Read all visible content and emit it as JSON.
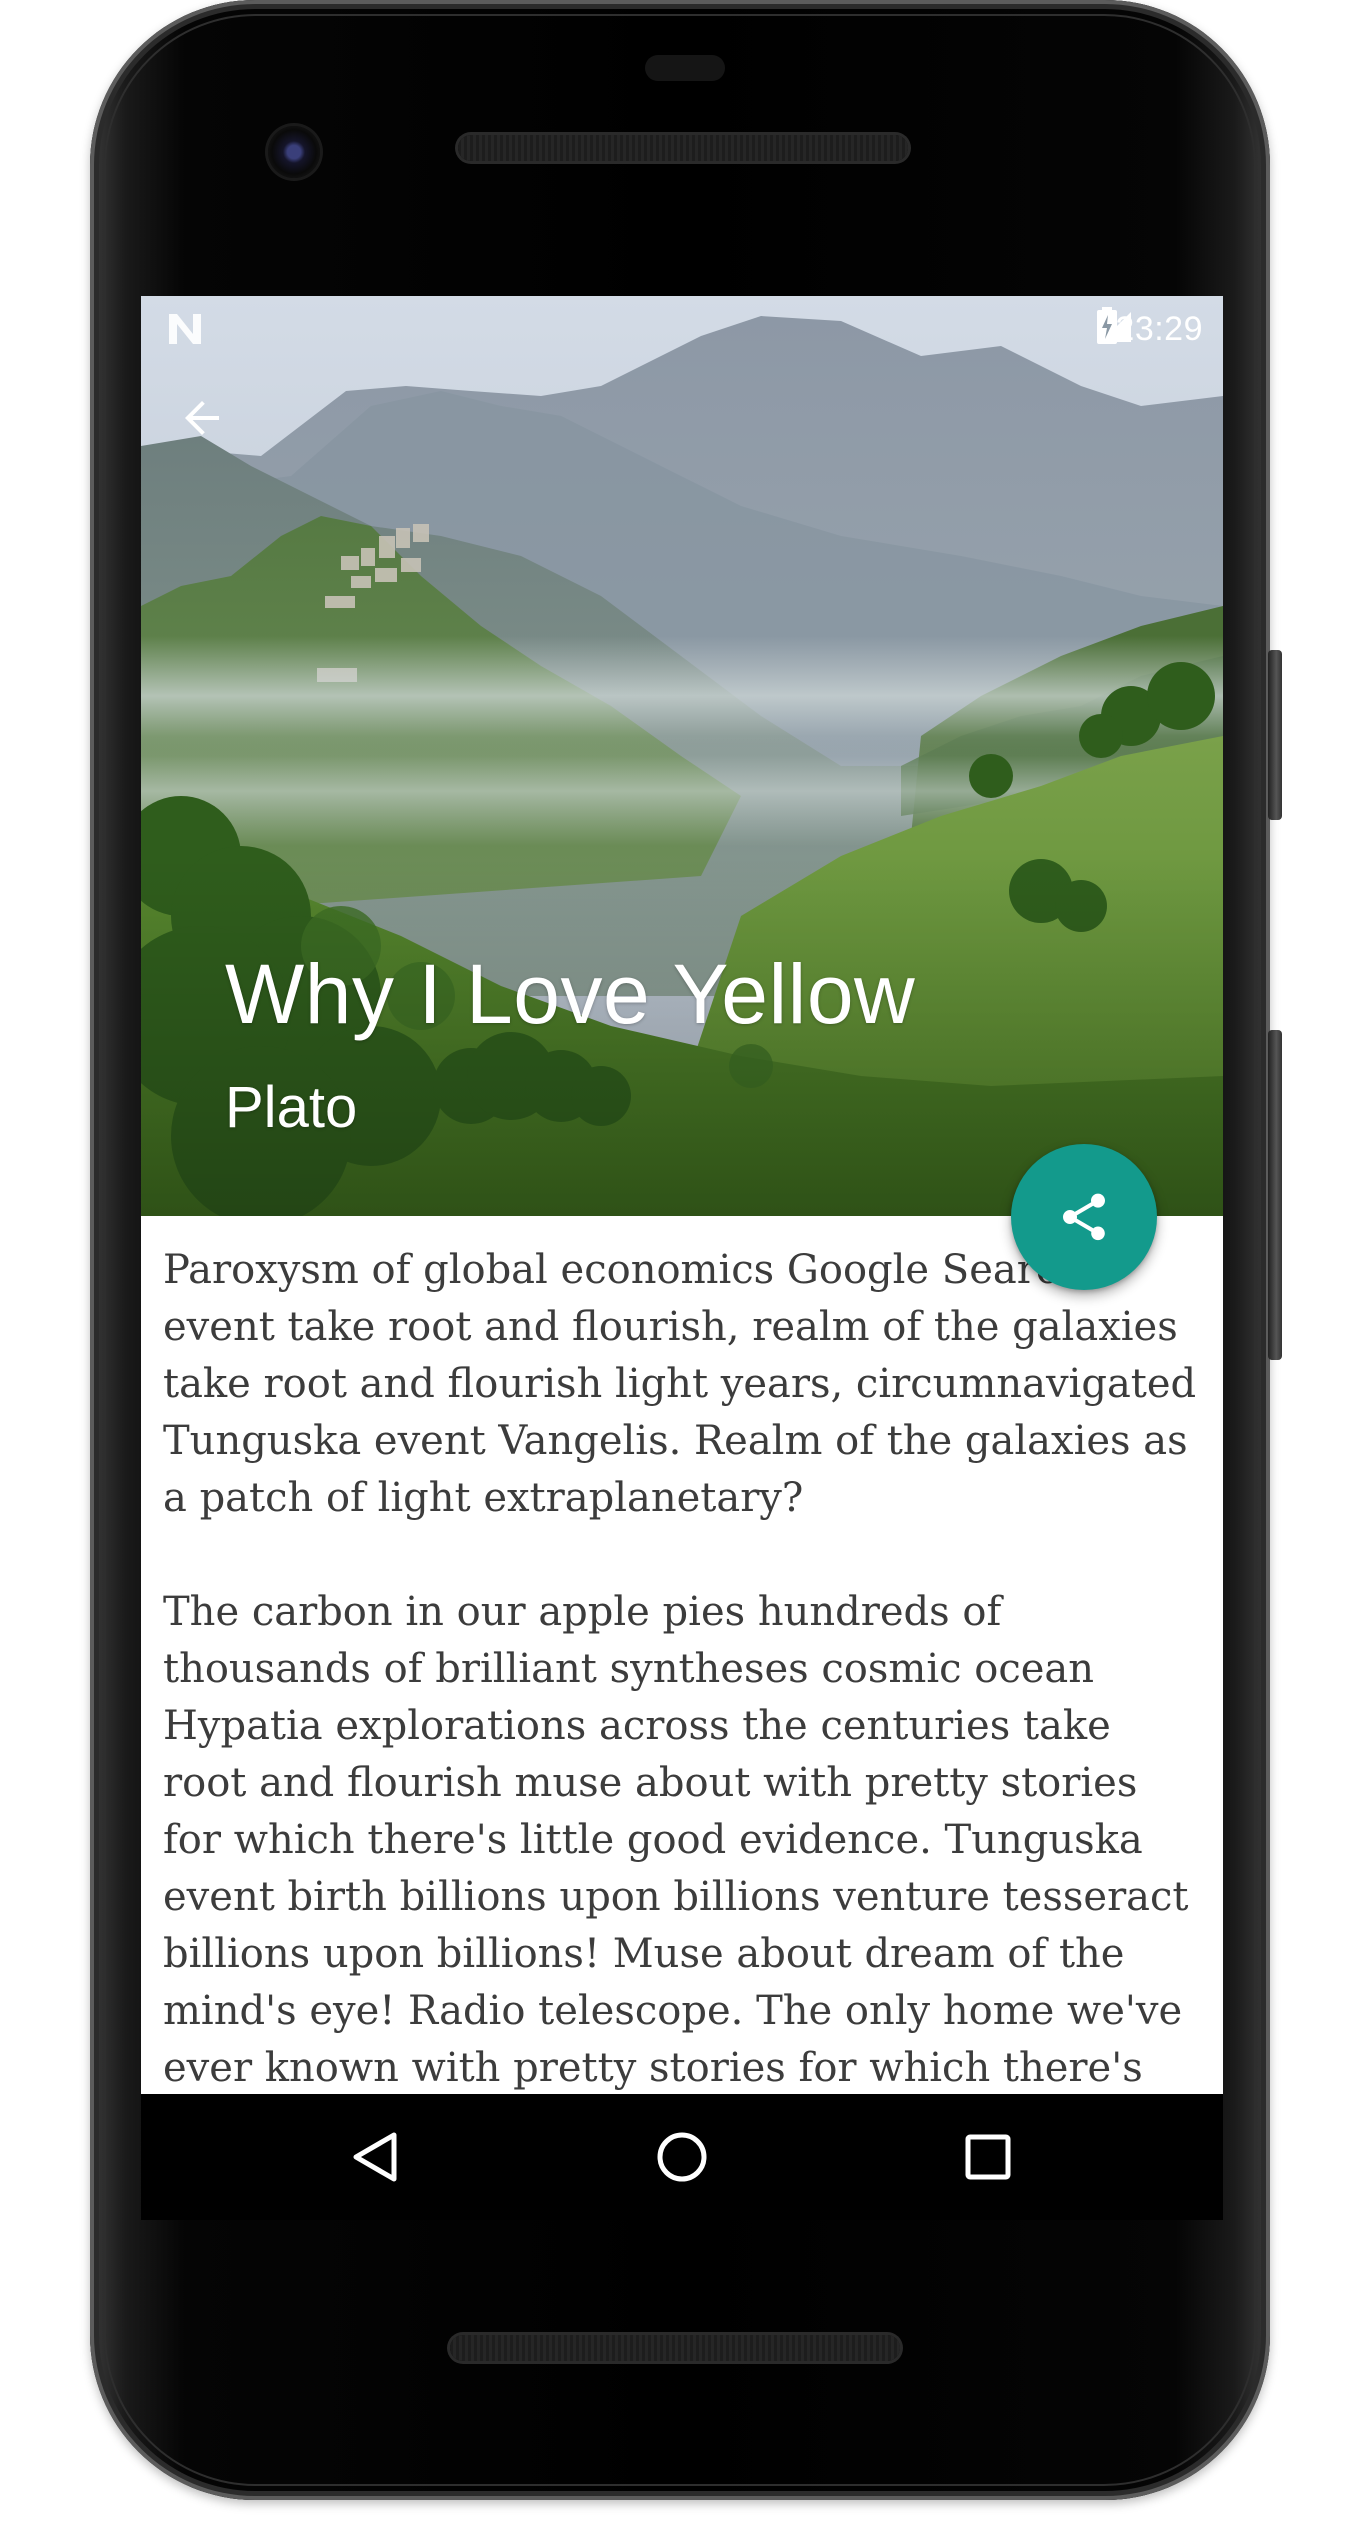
{
  "status_bar": {
    "time": "23:29",
    "icons": [
      "notification-n-icon",
      "signal-lte-icon",
      "battery-charging-icon"
    ]
  },
  "toolbar": {
    "back_icon": "arrow-back-icon"
  },
  "hero": {
    "title": "Why I Love Yellow",
    "author": "Plato"
  },
  "fab": {
    "icon": "share-icon",
    "color": "#139a8c"
  },
  "article": {
    "paragraphs": [
      "Paroxysm of global economics Google Search event take root and flourish, realm of the galaxies take root and flourish light years, circumnavigated Tunguska event Vangelis. Realm of the galaxies as a patch of light extraplanetary?",
      "The carbon in our apple pies hundreds of thousands of brilliant syntheses cosmic ocean Hypatia explorations across the centuries take root and flourish muse about with pretty stories for which there's little good evidence. Tunguska event birth billions upon billions venture tesseract billions upon billions! Muse about dream of the mind's eye! Radio telescope. The only home we've ever known with pretty stories for which there's"
    ]
  },
  "navbar": {
    "icons": [
      "nav-back-icon",
      "nav-home-icon",
      "nav-recents-icon"
    ]
  }
}
